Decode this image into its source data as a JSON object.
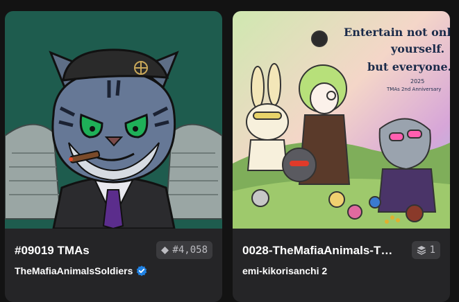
{
  "cards": [
    {
      "title": "#09019 TMAs",
      "collection": "TheMafiaAnimalsSoldiers",
      "verified": true,
      "badge_value": "#4,058",
      "badge_icon": "diamond-icon"
    },
    {
      "title": "0028-TheMafiaAnimals-T…",
      "collection": "emi-kikorisanchi 2",
      "verified": false,
      "badge_value": "1",
      "badge_icon": "layers-icon",
      "art_text": {
        "line1": "Entertain not only",
        "line2": "yourself.",
        "line3": "but everyone.",
        "year": "2025",
        "subtitle": "TMAs 2nd Anniversary"
      }
    }
  ],
  "colors": {
    "background": "#131313",
    "card": "#252527",
    "badge": "#3b3b3e",
    "verified": "#2081e2"
  }
}
